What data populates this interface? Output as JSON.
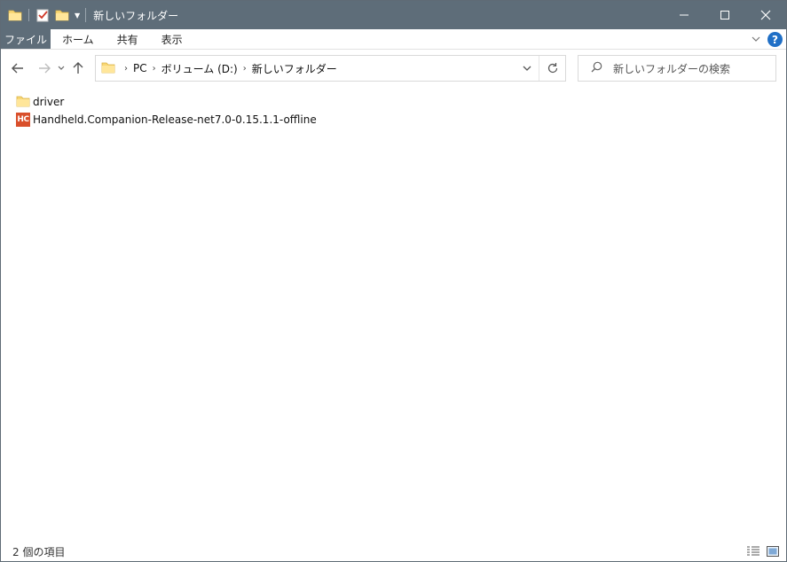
{
  "window": {
    "title": "新しいフォルダー",
    "colors": {
      "titlebar": "#5e6d79",
      "help": "#1f6fc6",
      "app_icon": "#d94f2b",
      "folder": "#f8d775"
    }
  },
  "ribbon": {
    "tabs": [
      {
        "label": "ファイル",
        "active": true
      },
      {
        "label": "ホーム"
      },
      {
        "label": "共有"
      },
      {
        "label": "表示"
      }
    ],
    "help_label": "?"
  },
  "address": {
    "crumbs": [
      "PC",
      "ボリューム (D:)",
      "新しいフォルダー"
    ]
  },
  "search": {
    "placeholder": "新しいフォルダーの検索"
  },
  "files": [
    {
      "name": "driver",
      "icon": "folder-icon"
    },
    {
      "name": "Handheld.Companion-Release-net7.0-0.15.1.1-offline",
      "icon": "hc-app-icon",
      "icon_text": "HC"
    }
  ],
  "status": {
    "item_count": "2 個の項目"
  }
}
